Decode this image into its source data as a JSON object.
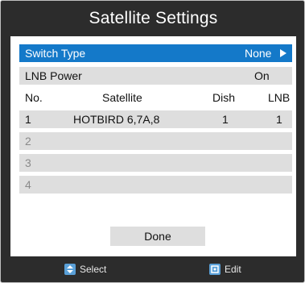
{
  "title": "Satellite Settings",
  "switch_type": {
    "label": "Switch Type",
    "value": "None"
  },
  "lnb_power": {
    "label": "LNB Power",
    "value": "On"
  },
  "table": {
    "headers": {
      "no": "No.",
      "satellite": "Satellite",
      "dish": "Dish",
      "lnb": "LNB"
    },
    "rows": [
      {
        "no": "1",
        "satellite": "HOTBIRD 6,7A,8",
        "dish": "1",
        "lnb": "1"
      },
      {
        "no": "2",
        "satellite": "",
        "dish": "",
        "lnb": ""
      },
      {
        "no": "3",
        "satellite": "",
        "dish": "",
        "lnb": ""
      },
      {
        "no": "4",
        "satellite": "",
        "dish": "",
        "lnb": ""
      }
    ]
  },
  "done_label": "Done",
  "footer": {
    "select": {
      "icon": "select-arrows-icon",
      "label": "Select"
    },
    "edit": {
      "icon": "edit-icon",
      "label": "Edit"
    }
  },
  "colors": {
    "highlight": "#1479c9",
    "row_bg": "#dedede",
    "frame_bg": "#2c2c2c"
  }
}
